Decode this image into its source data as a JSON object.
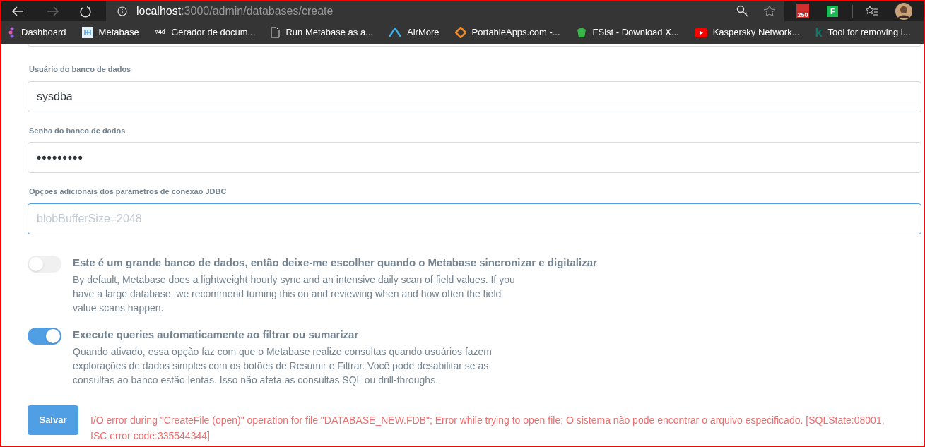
{
  "browser": {
    "url_host": "localhost",
    "url_path": ":3000/admin/databases/create",
    "gmail_count": "250",
    "extension_letter": "F"
  },
  "bookmarks": [
    {
      "label": "Dashboard"
    },
    {
      "label": "Metabase"
    },
    {
      "label": "Gerador de docum...",
      "icon_text": "#4d"
    },
    {
      "label": "Run Metabase as a..."
    },
    {
      "label": "AirMore"
    },
    {
      "label": "PortableApps.com -..."
    },
    {
      "label": "FSist - Download X..."
    },
    {
      "label": "Kaspersky Network..."
    },
    {
      "label": "Tool for removing i...",
      "icon_text": "k"
    }
  ],
  "fields": [
    {
      "label": "Usuário do banco de dados",
      "value": "sysdba",
      "focused": false
    },
    {
      "label": "Senha do banco de dados",
      "value": "•••••••••",
      "focused": false
    },
    {
      "label": "Opções adicionais dos parâmetros de conexão JDBC",
      "placeholder": "blobBufferSize=2048",
      "focused": true
    }
  ],
  "toggles": [
    {
      "title": "Este é um grande banco de dados, então deixe-me escolher quando o Metabase sincronizar e digitalizar",
      "description": "By default, Metabase does a lightweight hourly sync and an intensive daily scan of field values. If you have a large database, we recommend turning this on and reviewing when and how often the field value scans happen.",
      "on": false
    },
    {
      "title": "Execute queries automaticamente ao filtrar ou sumarizar",
      "description": "Quando ativado, essa opção faz com que o Metabase realize consultas quando usuários fazem explorações de dados simples com os botões de Resumir e Filtrar. Você pode desabilitar se as consultas ao banco estão lentas. Isso não afeta as consultas SQL ou drill-throughs.",
      "on": true
    }
  ],
  "save_button": "Salvar",
  "error": "I/O error during \"CreateFile (open)\" operation for file \"DATABASE_NEW.FDB\"; Error while trying to open file; O sistema não pode encontrar o arquivo especificado. [SQLState:08001, ISC error code:335544344]"
}
